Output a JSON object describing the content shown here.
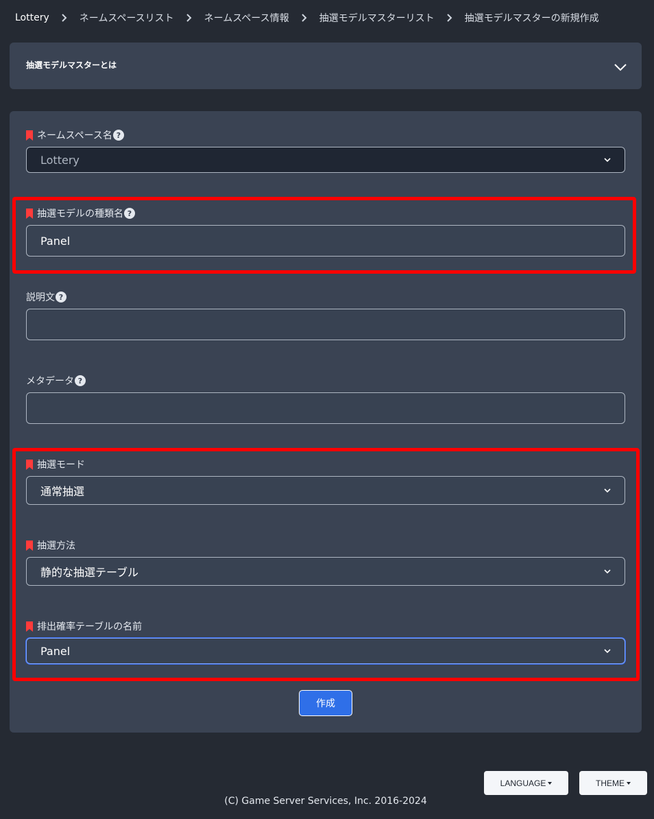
{
  "breadcrumb": [
    "Lottery",
    "ネームスペースリスト",
    "ネームスペース情報",
    "抽選モデルマスターリスト",
    "抽選モデルマスターの新規作成"
  ],
  "about": {
    "title": "抽選モデルマスターとは"
  },
  "form": {
    "namespace": {
      "label": "ネームスペース名",
      "value": "Lottery"
    },
    "model_name": {
      "label": "抽選モデルの種類名",
      "value": "Panel"
    },
    "description": {
      "label": "説明文",
      "value": ""
    },
    "metadata": {
      "label": "メタデータ",
      "value": ""
    },
    "mode": {
      "label": "抽選モード",
      "value": "通常抽選"
    },
    "method": {
      "label": "抽選方法",
      "value": "静的な抽選テーブル"
    },
    "table_name": {
      "label": "排出確率テーブルの名前",
      "value": "Panel"
    },
    "create_label": "作成"
  },
  "footer": {
    "language_label": "LANGUAGE",
    "theme_label": "THEME",
    "copyright": "(C) Game Server Services, Inc. 2016-2024"
  },
  "colors": {
    "background": "#252a33",
    "panel": "#3a4353",
    "required_marker": "#ff3b3b",
    "primary_button": "#2f6fe8",
    "highlight_box": "#ff0000"
  }
}
